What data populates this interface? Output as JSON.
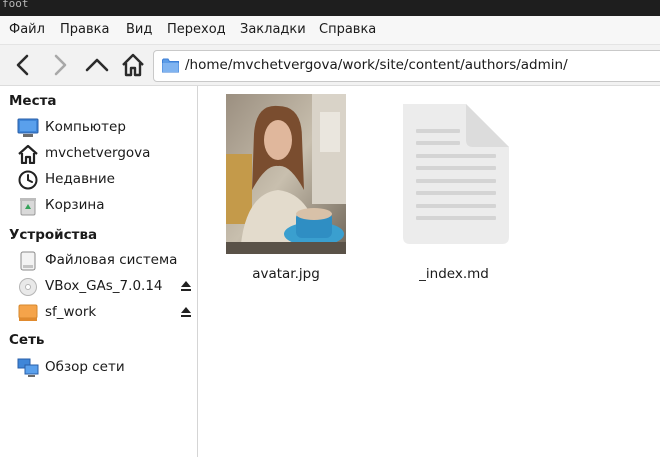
{
  "window": {
    "title": "foot"
  },
  "menu": {
    "items": [
      {
        "label": "Файл"
      },
      {
        "label": "Правка"
      },
      {
        "label": "Вид"
      },
      {
        "label": "Переход"
      },
      {
        "label": "Закладки"
      },
      {
        "label": "Справка"
      }
    ]
  },
  "toolbar": {
    "back_icon": "chevron-left-icon",
    "forward_icon": "chevron-right-icon",
    "up_icon": "chevron-up-icon",
    "home_icon": "home-icon",
    "path": "/home/mvchetvergova/work/site/content/authors/admin/"
  },
  "sidebar": {
    "places": {
      "heading": "Места",
      "items": [
        {
          "label": "Компьютер",
          "icon": "computer-icon"
        },
        {
          "label": "mvchetvergova",
          "icon": "home-icon"
        },
        {
          "label": "Недавние",
          "icon": "clock-icon"
        },
        {
          "label": "Корзина",
          "icon": "trash-icon"
        }
      ]
    },
    "devices": {
      "heading": "Устройства",
      "items": [
        {
          "label": "Файловая система",
          "icon": "drive-icon"
        },
        {
          "label": "VBox_GAs_7.0.14",
          "icon": "optical-disc-icon",
          "ejectable": true
        },
        {
          "label": "sf_work",
          "icon": "drive-orange-icon",
          "ejectable": true
        }
      ]
    },
    "network": {
      "heading": "Сеть",
      "items": [
        {
          "label": "Обзор сети",
          "icon": "network-icon"
        }
      ]
    }
  },
  "files": [
    {
      "name": "avatar.jpg",
      "type": "image"
    },
    {
      "name": "_index.md",
      "type": "text-document"
    }
  ],
  "colors": {
    "titlebar": "#1e1e1e",
    "accent_blue": "#3d7fd6",
    "orange": "#f5a44a"
  }
}
